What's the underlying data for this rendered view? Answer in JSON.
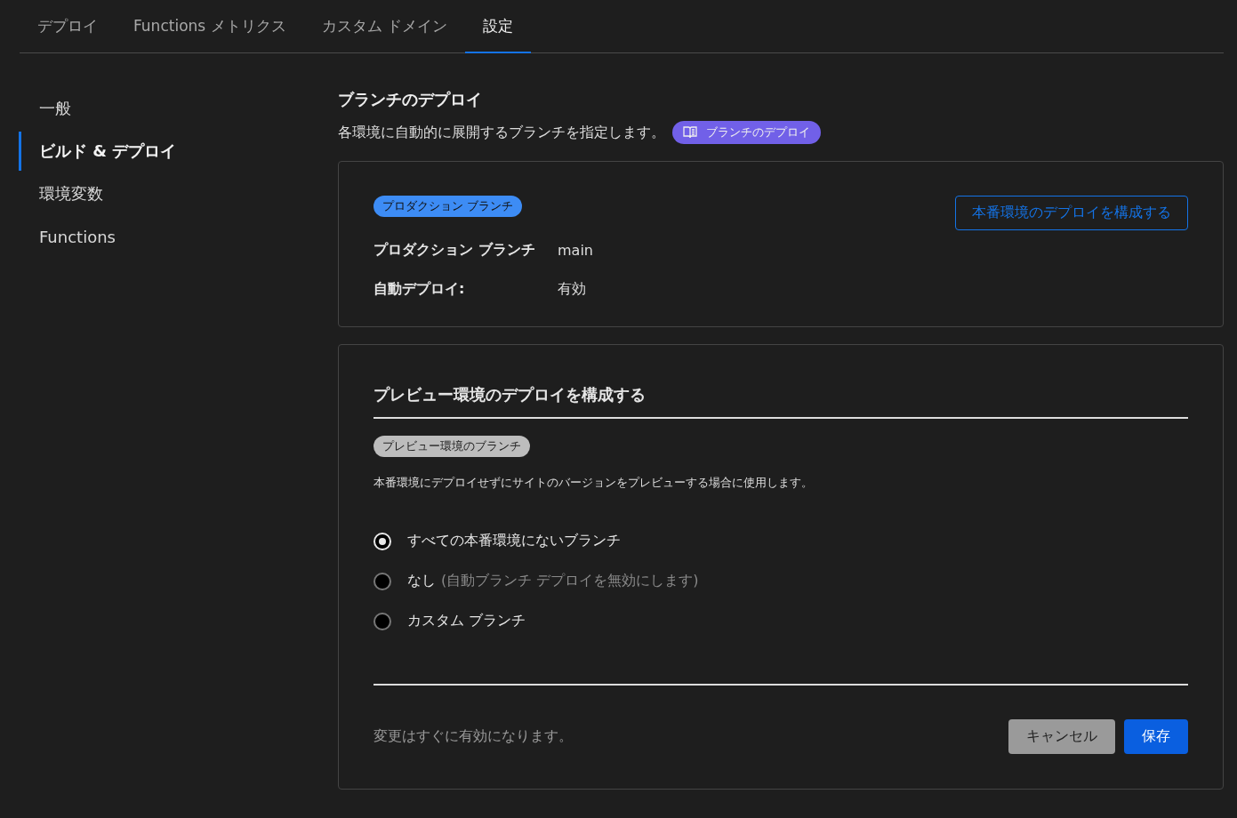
{
  "tabs": [
    {
      "label": "デプロイ",
      "selected": false
    },
    {
      "label": "Functions メトリクス",
      "selected": false
    },
    {
      "label": "カスタム ドメイン",
      "selected": false
    },
    {
      "label": "設定",
      "selected": true
    }
  ],
  "sidebar": {
    "items": [
      {
        "label": "一般",
        "selected": false
      },
      {
        "label": "ビルド & デプロイ",
        "selected": true
      },
      {
        "label": "環境変数",
        "selected": false
      },
      {
        "label": "Functions",
        "selected": false
      }
    ]
  },
  "section": {
    "title": "ブランチのデプロイ",
    "description": "各環境に自動的に展開するブランチを指定します。",
    "doc_link": "ブランチのデプロイ"
  },
  "production_card": {
    "badge": "プロダクション ブランチ",
    "configure_button": "本番環境のデプロイを構成する",
    "fields": [
      {
        "label": "プロダクション ブランチ",
        "value": "main"
      },
      {
        "label": "自動デプロイ:",
        "value": "有効"
      }
    ]
  },
  "preview_card": {
    "title": "プレビュー環境のデプロイを構成する",
    "badge": "プレビュー環境のブランチ",
    "description": "本番環境にデプロイせずにサイトのバージョンをプレビューする場合に使用します。",
    "options": [
      {
        "label": "すべての本番環境にないブランチ",
        "selected": true
      },
      {
        "label": "なし",
        "hint": "(自動ブランチ デプロイを無効にします)",
        "selected": false
      },
      {
        "label": "カスタム ブランチ",
        "selected": false
      }
    ],
    "footer_note": "変更はすぐに有効になります。",
    "cancel_button": "キャンセル",
    "save_button": "保存"
  }
}
